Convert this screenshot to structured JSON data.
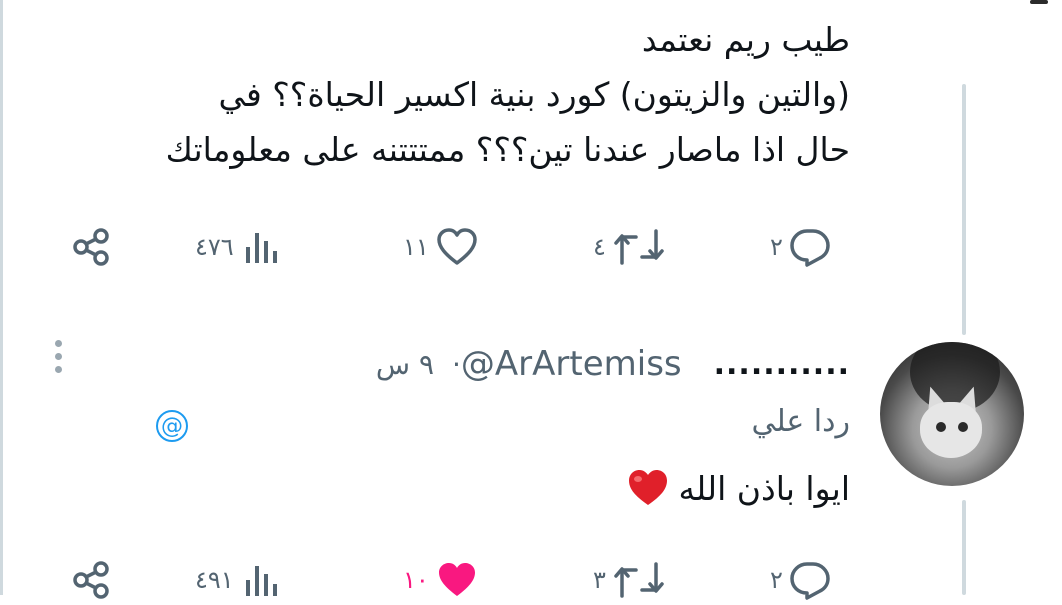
{
  "tweet": {
    "lines": [
      "طيب ريم نعتمد",
      "(والتين والزيتون) كورد بنية اكسير الحياة؟؟ في",
      "حال اذا ماصار عندنا تين؟؟؟ ممتتتنه على معلوماتك"
    ],
    "actions": {
      "replies": "٢",
      "retweets": "٤",
      "likes": "١١",
      "views": "٤٧٦"
    }
  },
  "reply": {
    "display_name": "...........",
    "handle": "@ArArtemiss",
    "separator": "·",
    "time": "٩ س",
    "replying_to": "ردا علي",
    "at_symbol": "@",
    "text": "ايوا باذن الله",
    "emoji": "heart",
    "actions": {
      "replies": "٢",
      "retweets": "٣",
      "likes": "١٠",
      "views": "٤٩١"
    },
    "liked": true,
    "like_color": "#f91880"
  },
  "colors": {
    "text": "#0f1419",
    "muted": "#536471",
    "accent": "#1d9bf0",
    "heart_emoji": "#e0202a"
  }
}
